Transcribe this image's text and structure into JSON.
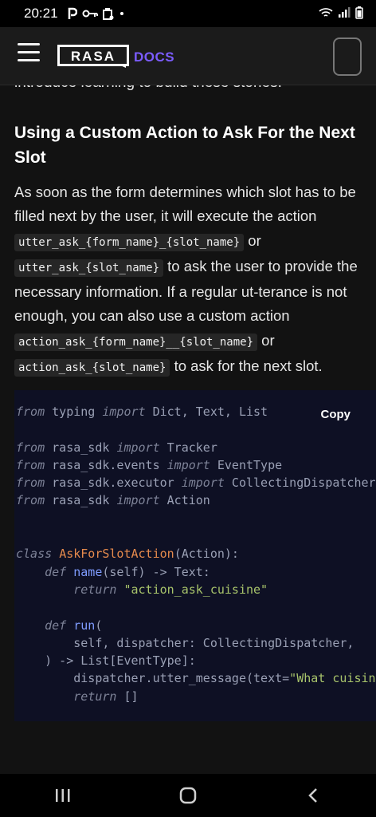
{
  "status_bar": {
    "time": "20:21",
    "icons": [
      "p-icon",
      "key-icon",
      "bag-icon",
      "dot-icon"
    ],
    "right_icons": [
      "wifi-icon",
      "signal-icon",
      "battery-icon"
    ]
  },
  "header": {
    "logo_text": "RASA",
    "docs_label": "DOCS",
    "accent_color": "#7b5cff"
  },
  "content": {
    "partial_line": "introduce learning to build these stories.",
    "heading": "Using a Custom Action to Ask For the Next Slot",
    "paragraph": {
      "t1": "As soon as the form determines which slot has to be filled next by the user, it will execute the action ",
      "c1": "utter_ask_{form_name}_{slot_name}",
      "t2": " or ",
      "c2": "utter_ask_{slot_name}",
      "t3": " to ask the user to provide the necessary information. If a regular ut-terance is not enough, you can also use a custom action ",
      "c3": "action_ask_{form_name}__{slot_name}",
      "t4": " or ",
      "c4": "action_ask_{slot_name}",
      "t5": " to ask for the next slot."
    }
  },
  "code": {
    "copy_label": "Copy",
    "l1": {
      "a": "from",
      "b": " typing ",
      "c": "import",
      "d": " Dict, Text, List"
    },
    "l3": {
      "a": "from",
      "b": " rasa_sdk ",
      "c": "import",
      "d": " Tracker"
    },
    "l4": {
      "a": "from",
      "b": " rasa_sdk.events ",
      "c": "import",
      "d": " EventType"
    },
    "l5": {
      "a": "from",
      "b": " rasa_sdk.executor ",
      "c": "import",
      "d": " CollectingDispatcher"
    },
    "l6": {
      "a": "from",
      "b": " rasa_sdk ",
      "c": "import",
      "d": " Action"
    },
    "l9": {
      "a": "class",
      "b": " ",
      "c": "AskForSlotAction",
      "d": "(Action):"
    },
    "l10": {
      "a": "    ",
      "b": "def",
      "c": " ",
      "d": "name",
      "e": "(self) -> Text:"
    },
    "l11": {
      "a": "        ",
      "b": "return",
      "c": " ",
      "d": "\"action_ask_cuisine\""
    },
    "l13": {
      "a": "    ",
      "b": "def",
      "c": " ",
      "d": "run",
      "e": "("
    },
    "l14": "        self, dispatcher: CollectingDispatcher,",
    "l15": ") -> List[EventType]:",
    "l16": {
      "a": "        dispatcher.utter_message(text=",
      "b": "\"What cuisine?\"",
      "c": ")"
    },
    "l17": {
      "a": "        ",
      "b": "return",
      "c": " []"
    }
  },
  "nav": {
    "buttons": [
      "recent-apps",
      "home",
      "back"
    ]
  }
}
